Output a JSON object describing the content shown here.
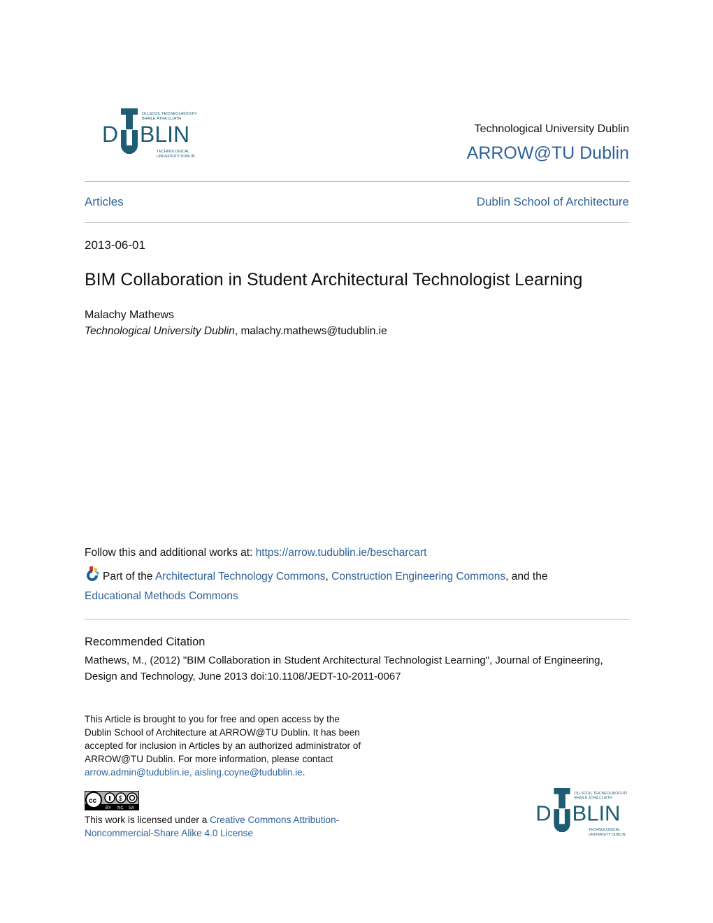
{
  "header": {
    "logo_alt": "Technological University Dublin logo",
    "logo_text": {
      "irish_line1": "OLLSCOIL TEICNEOLAÍOCHTA",
      "irish_line2": "BHAILE ÁTHA CLIATH",
      "wordmark": "DUBLIN",
      "english_line1": "TECHNOLOGICAL",
      "english_line2": "UNIVERSITY DUBLIN"
    },
    "institution": "Technological University Dublin",
    "repository": "ARROW@TU Dublin"
  },
  "nav": {
    "collection": "Articles",
    "school": "Dublin School of Architecture"
  },
  "article": {
    "date": "2013-06-01",
    "title": "BIM Collaboration in Student Architectural Technologist Learning",
    "author": "Malachy Mathews",
    "affiliation": "Technological University Dublin",
    "affiliation_sep": ", ",
    "email": "malachy.mathews@tudublin.ie"
  },
  "follow": {
    "label": "Follow this and additional works at: ",
    "url": "https://arrow.tudublin.ie/bescharcart"
  },
  "part_of": {
    "icon": "commons-network-icon",
    "prefix": "Part of the ",
    "commons": [
      "Architectural Technology Commons",
      "Construction Engineering Commons",
      "Educational Methods Commons"
    ],
    "sep1": ", ",
    "sep2": ", and the"
  },
  "citation": {
    "heading": "Recommended Citation",
    "text": "Mathews, M., (2012) \"BIM Collaboration in Student Architectural Technologist Learning\", Journal of Engineering, Design and Technology, June 2013 doi:10.1108/JEDT-10-2011-0067"
  },
  "access_notice": {
    "text": "This Article is brought to you for free and open access by the Dublin School of Architecture at ARROW@TU Dublin. It has been accepted for inclusion in Articles by an authorized administrator of ARROW@TU Dublin. For more information, please contact ",
    "contact1": "arrow.admin@tudublin.ie,",
    "space": " ",
    "contact2": "aisling.coyne@tudublin.ie",
    "end": "."
  },
  "license": {
    "badge_icon": "cc-by-nc-sa-icon",
    "badge_labels": [
      "BY",
      "NC",
      "SA"
    ],
    "prefix": "This work is licensed under a ",
    "link": "Creative Commons Attribution-Noncommercial-Share Alike 4.0 License"
  },
  "colors": {
    "link": "#2e6299",
    "logo": "#1d5c73",
    "rule": "#bdbdbd"
  }
}
